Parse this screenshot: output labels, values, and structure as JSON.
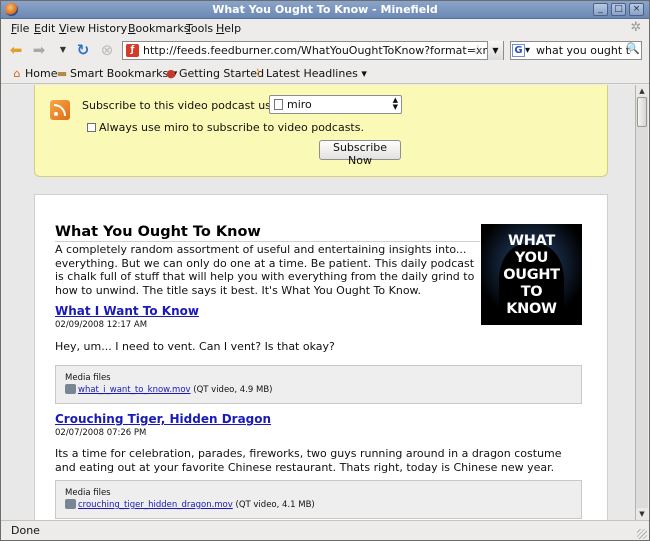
{
  "window": {
    "title": "What You Ought To Know - Minefield",
    "controls": {
      "minimize": "_",
      "maximize": "□",
      "close": "×"
    }
  },
  "menu": [
    "File",
    "Edit",
    "View",
    "History",
    "Bookmarks",
    "Tools",
    "Help"
  ],
  "menu_underline": [
    "F",
    "E",
    "V",
    "",
    "B",
    "T",
    "H"
  ],
  "navigation": {
    "url": "http://feeds.feedburner.com/WhatYouOughtToKnow?format=xml",
    "search_value": "what you ought to know"
  },
  "bookmarks": [
    {
      "label": "Home",
      "icon": "home-icon"
    },
    {
      "label": "Smart Bookmarks ▾",
      "icon": "folder-icon"
    },
    {
      "label": "Getting Started",
      "icon": "firefox-icon"
    },
    {
      "label": "Latest Headlines ▾",
      "icon": "rss-icon"
    }
  ],
  "subscribe": {
    "label": "Subscribe to this video podcast using",
    "reader": "miro",
    "checkbox_label": "Always use miro to subscribe to video podcasts.",
    "button": "Subscribe Now"
  },
  "feed": {
    "title": "What You Ought To Know",
    "description": "A completely random assortment of useful and entertaining insights into... everything. But we can only do one at a time. Be patient. This daily podcast is chalk full of stuff that will help you with everything from the daily grind to how to unwind. The title says it best. It's What You Ought To Know.",
    "artwork_lines": [
      "WHAT",
      "YOU",
      "OUGHT",
      "TO",
      "KNOW"
    ]
  },
  "entries": [
    {
      "title": "What I Want To Know",
      "date": "02/09/2008 12:17 AM",
      "body": "Hey, um... I need to vent. Can I vent? Is that okay?",
      "media_label": "Media files",
      "file": "what_i_want_to_know.mov",
      "file_info": "(QT video, 4.9 MB)"
    },
    {
      "title": "Crouching Tiger, Hidden Dragon",
      "date": "02/07/2008 07:26 PM",
      "body": "Its a time for celebration, parades, fireworks, two guys running around in a dragon costume and eating out at your favorite Chinese restaurant. Thats right, today is Chinese new year.",
      "media_label": "Media files",
      "file": "crouching_tiger_hidden_dragon.mov",
      "file_info": "(QT video, 4.1 MB)"
    }
  ],
  "status": "Done"
}
